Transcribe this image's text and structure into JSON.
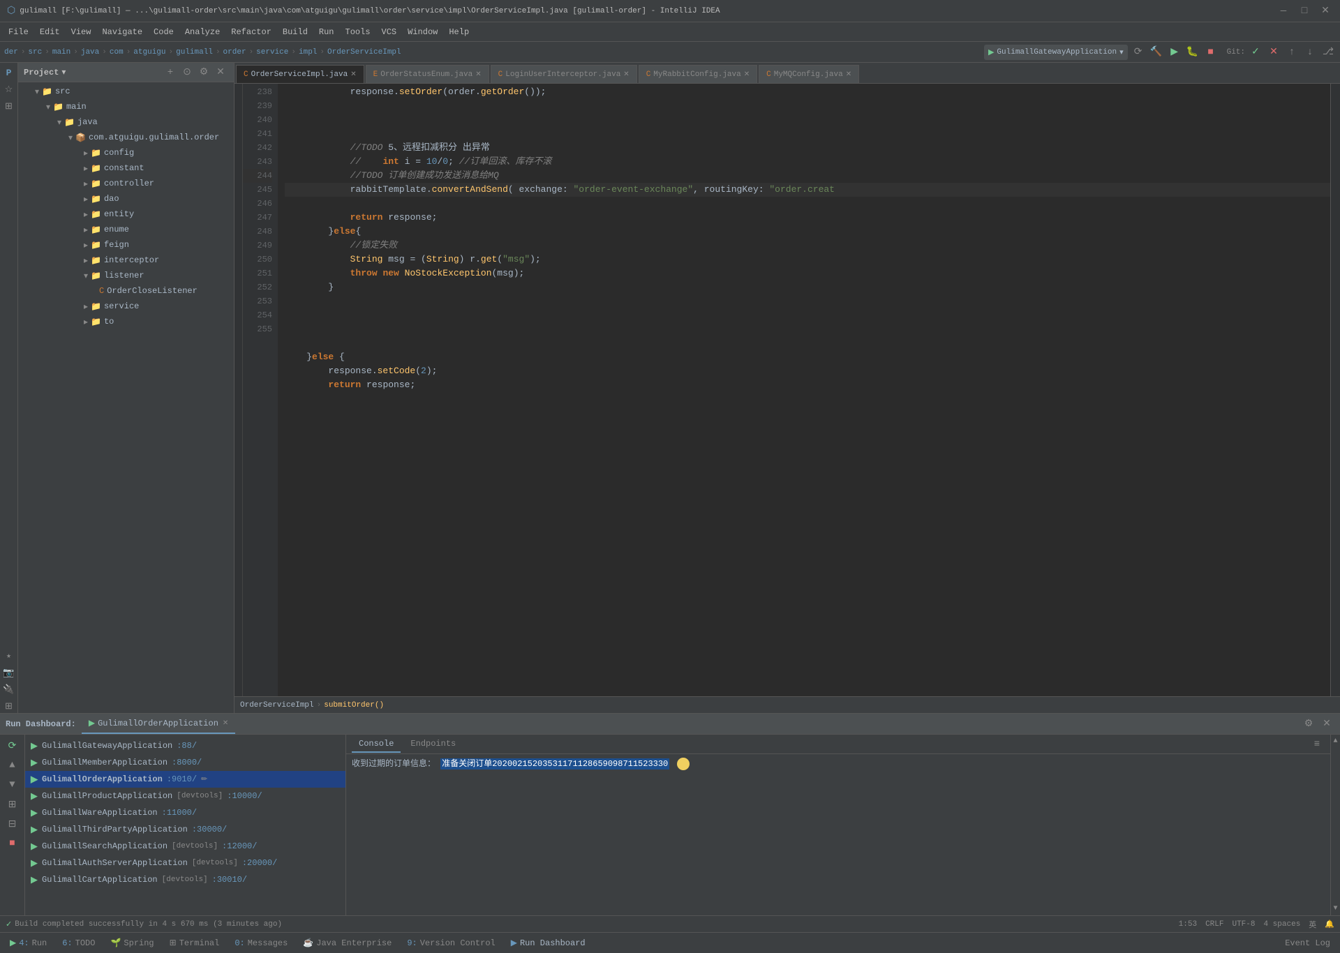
{
  "titleBar": {
    "title": "gulimall [F:\\gulimall] — ...\\gulimall-order\\src\\main\\java\\com\\atguigu\\gulimall\\order\\service\\impl\\OrderServiceImpl.java [gulimall-order] - IntelliJ IDEA",
    "minLabel": "—",
    "maxLabel": "□",
    "closeLabel": "✕"
  },
  "menuBar": {
    "items": [
      "File",
      "Edit",
      "View",
      "Navigate",
      "Code",
      "Analyze",
      "Refactor",
      "Build",
      "Run",
      "Tools",
      "VCS",
      "Window",
      "Help"
    ]
  },
  "toolbar": {
    "breadcrumbs": [
      "der",
      "src",
      "main",
      "java",
      "com",
      "atguigu",
      "gulimall",
      "order",
      "service",
      "impl",
      "OrderServiceImpl"
    ],
    "runConfig": "GulimallGatewayApplication",
    "gitLabel": "Git:"
  },
  "projectPanel": {
    "title": "Project",
    "tree": [
      {
        "label": "src",
        "type": "folder",
        "indent": 20,
        "expanded": true
      },
      {
        "label": "main",
        "type": "folder",
        "indent": 36,
        "expanded": true
      },
      {
        "label": "java",
        "type": "folder",
        "indent": 52,
        "expanded": true
      },
      {
        "label": "com.atguigu.gulimall.order",
        "type": "package",
        "indent": 68,
        "expanded": true
      },
      {
        "label": "config",
        "type": "folder",
        "indent": 90,
        "expanded": false
      },
      {
        "label": "constant",
        "type": "folder",
        "indent": 90,
        "expanded": false
      },
      {
        "label": "controller",
        "type": "folder",
        "indent": 90,
        "expanded": false
      },
      {
        "label": "dao",
        "type": "folder",
        "indent": 90,
        "expanded": false
      },
      {
        "label": "entity",
        "type": "folder",
        "indent": 90,
        "expanded": false
      },
      {
        "label": "enume",
        "type": "folder",
        "indent": 90,
        "expanded": false
      },
      {
        "label": "feign",
        "type": "folder",
        "indent": 90,
        "expanded": false
      },
      {
        "label": "interceptor",
        "type": "folder",
        "indent": 90,
        "expanded": false
      },
      {
        "label": "listener",
        "type": "folder",
        "indent": 90,
        "expanded": true
      },
      {
        "label": "OrderCloseListener",
        "type": "java",
        "indent": 110,
        "expanded": false
      },
      {
        "label": "service",
        "type": "folder",
        "indent": 90,
        "expanded": false
      },
      {
        "label": "to",
        "type": "folder",
        "indent": 90,
        "expanded": false
      }
    ]
  },
  "editorTabs": [
    {
      "label": "OrderServiceImpl.java",
      "active": true,
      "icon": "java"
    },
    {
      "label": "OrderStatusEnum.java",
      "active": false,
      "icon": "java"
    },
    {
      "label": "LoginUserInterceptor.java",
      "active": false,
      "icon": "java"
    },
    {
      "label": "MyRabbitConfig.java",
      "active": false,
      "icon": "java"
    },
    {
      "label": "MyMQConfig.java",
      "active": false,
      "icon": "java"
    }
  ],
  "codeLines": [
    {
      "num": 238,
      "content": "            response.setOrder(order.getOrder());"
    },
    {
      "num": 239,
      "content": ""
    },
    {
      "num": 240,
      "content": ""
    },
    {
      "num": 241,
      "content": "            //TODO 5、远程扣减积分 出异常"
    },
    {
      "num": 242,
      "content": "            //    int i = 10/0; //订单回滚、库存不滚"
    },
    {
      "num": 243,
      "content": "            //TODO 订单创建成功发送消息给MQ"
    },
    {
      "num": 244,
      "content": "            rabbitTemplate.convertAndSend( exchange: \"order-event-exchange\", routingKey: \"order.creat"
    },
    {
      "num": 245,
      "content": "            return response;"
    },
    {
      "num": 246,
      "content": "        }else{"
    },
    {
      "num": 247,
      "content": "            //锁定失败"
    },
    {
      "num": 248,
      "content": "            String msg = (String) r.get(\"msg\");"
    },
    {
      "num": 249,
      "content": "            throw new NoStockException(msg);"
    },
    {
      "num": 250,
      "content": "        }"
    },
    {
      "num": 251,
      "content": ""
    },
    {
      "num": 252,
      "content": ""
    },
    {
      "num": 253,
      "content": "    }else {"
    },
    {
      "num": 254,
      "content": "        response.setCode(2);"
    },
    {
      "num": 255,
      "content": "        return response;"
    }
  ],
  "breadcrumbEditor": {
    "path": "OrderServiceImpl > submitOrder()"
  },
  "bottomPanel": {
    "runDashboard": "Run Dashboard:",
    "appName": "GulimallOrderApplication",
    "consoleTabs": [
      "Console",
      "Endpoints"
    ],
    "consoleOutput": "收到过期的订单信息：",
    "consoleHighlight": "准备关闭订单20200215203531171128659098711523330",
    "services": [
      {
        "name": "GulimallGatewayApplication",
        "port": ":88/",
        "tag": "",
        "running": true
      },
      {
        "name": "GulimallMemberApplication",
        "port": ":8000/",
        "tag": "",
        "running": true
      },
      {
        "name": "GulimallOrderApplication",
        "port": ":9010/",
        "tag": "",
        "running": true,
        "active": true
      },
      {
        "name": "GulimallProductApplication",
        "port": ":10000/",
        "tag": "[devtools]",
        "running": true
      },
      {
        "name": "GulimallWareApplication",
        "port": ":11000/",
        "tag": "",
        "running": true
      },
      {
        "name": "GulimallThirdPartyApplication",
        "port": ":30000/",
        "tag": "",
        "running": true
      },
      {
        "name": "GulimallSearchApplication",
        "port": ":12000/",
        "tag": "[devtools]",
        "running": true
      },
      {
        "name": "GulimallAuthServerApplication",
        "port": ":20000/",
        "tag": "[devtools]",
        "running": true
      },
      {
        "name": "GulimallCartApplication",
        "port": ":30010/",
        "tag": "[devtools]",
        "running": true
      }
    ]
  },
  "statusBar": {
    "buildStatus": "Build completed successfully in 4 s 670 ms (3 minutes ago)",
    "position": "1:53",
    "lineEnding": "CRLF",
    "encoding": "UTF-8",
    "indent": "4 spaces"
  },
  "taskbar": {
    "items": [
      {
        "num": "4",
        "label": "Run",
        "active": false
      },
      {
        "num": "6",
        "label": "TODO",
        "active": false
      },
      {
        "num": "",
        "label": "Spring",
        "active": false
      },
      {
        "num": "",
        "label": "Terminal",
        "active": false
      },
      {
        "num": "0",
        "label": "Messages",
        "active": false
      },
      {
        "num": "",
        "label": "Java Enterprise",
        "active": false
      },
      {
        "num": "9",
        "label": "Version Control",
        "active": false
      },
      {
        "num": "",
        "label": "Run Dashboard",
        "active": true
      },
      {
        "num": "",
        "label": "Event Log",
        "active": false
      }
    ]
  }
}
